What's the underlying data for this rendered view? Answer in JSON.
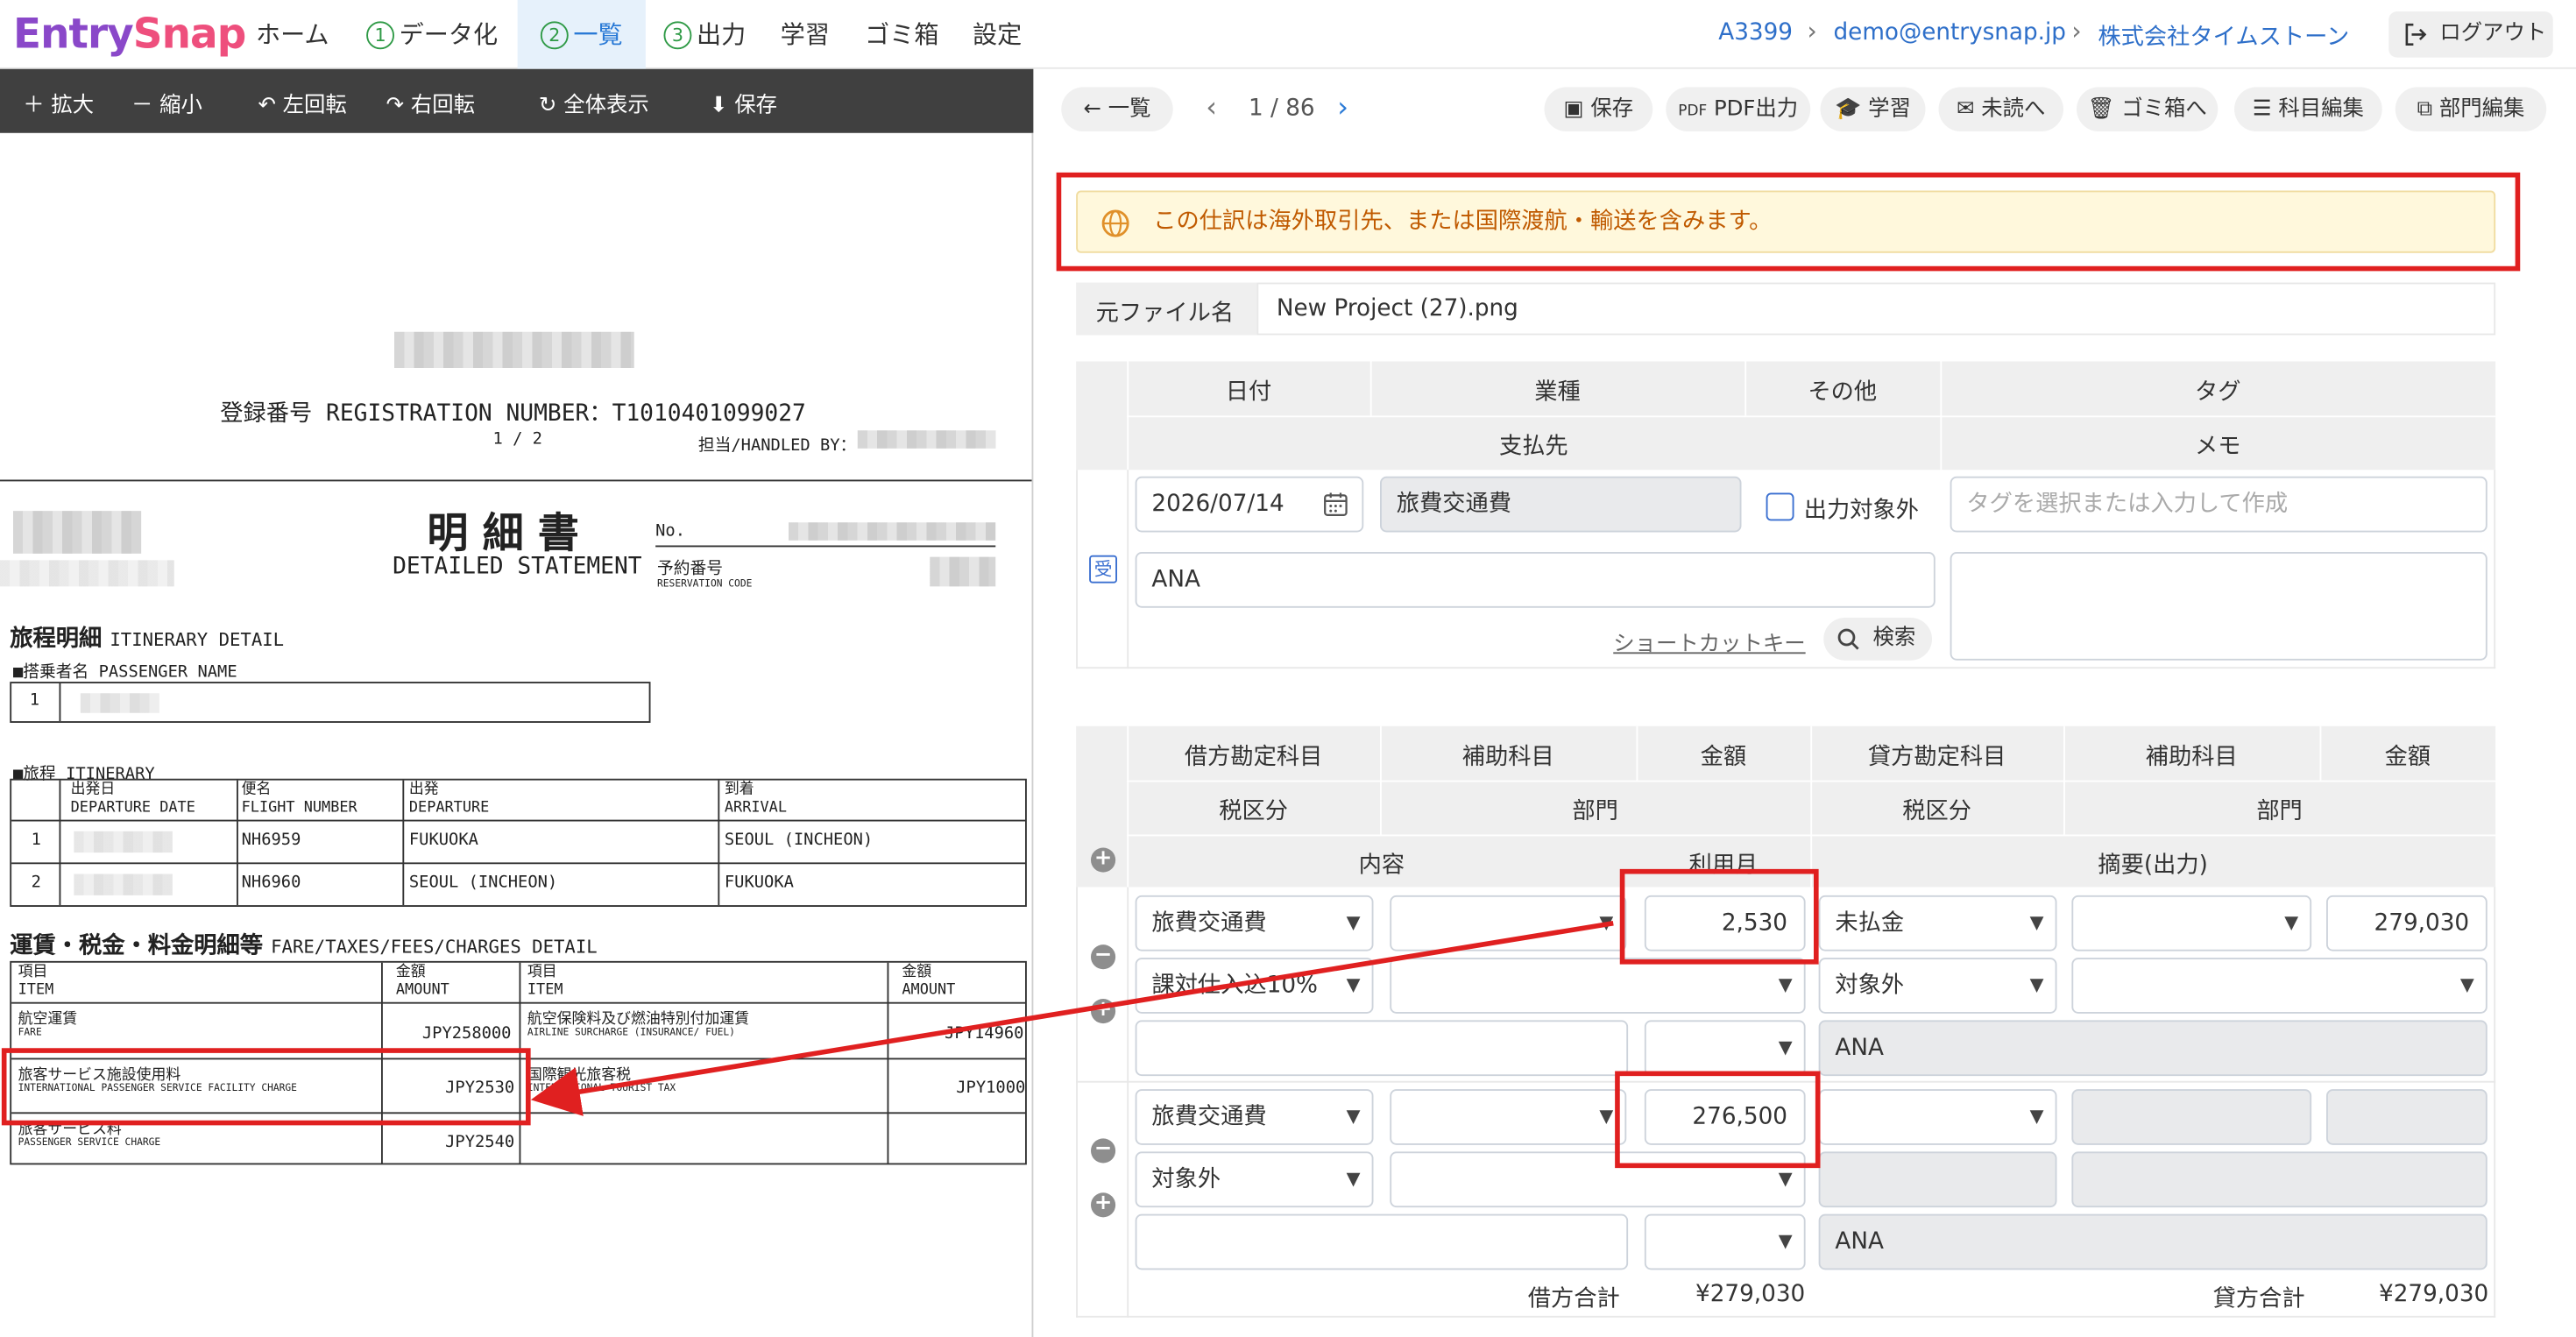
{
  "header": {
    "logo_a": "Entry",
    "logo_b": "Snap",
    "nav": [
      {
        "label": "ホーム"
      },
      {
        "num": "1",
        "label": "データ化"
      },
      {
        "num": "2",
        "label": "一覧"
      },
      {
        "num": "3",
        "label": "出力"
      },
      {
        "label": "学習"
      },
      {
        "label": "ゴミ箱"
      },
      {
        "label": "設定"
      }
    ],
    "breadcrumb": [
      "A3399",
      "demo@entrysnap.jp",
      "株式会社タイムストーン"
    ],
    "logout": "ログアウト"
  },
  "viewer_toolbar": [
    "拡大",
    "縮小",
    "左回転",
    "右回転",
    "全体表示",
    "保存"
  ],
  "document": {
    "reg": "登録番号 REGISTRATION NUMBER：T1010401099027",
    "page": "1 / 2",
    "handled": "担当/HANDLED BY：",
    "title_jp": "明 細 書",
    "title_en": "DETAILED STATEMENT",
    "no": "No.",
    "resv_jp": "予約番号",
    "resv_en": "RESERVATION CODE",
    "itin_title": "旅程明細",
    "itin_title_en": "ITINERARY DETAIL",
    "pax": "■搭乗者名 PASSENGER NAME",
    "pax_no": "1",
    "itin": "■旅程 ITINERARY",
    "cols": [
      {
        "jp": "出発日",
        "en": "DEPARTURE DATE"
      },
      {
        "jp": "便名",
        "en": "FLIGHT NUMBER"
      },
      {
        "jp": "出発",
        "en": "DEPARTURE"
      },
      {
        "jp": "到着",
        "en": "ARRIVAL"
      }
    ],
    "rows": [
      {
        "no": "1",
        "flight": "NH6959",
        "dep": "FUKUOKA",
        "arr": "SEOUL (INCHEON)"
      },
      {
        "no": "2",
        "flight": "NH6960",
        "dep": "SEOUL (INCHEON)",
        "arr": "FUKUOKA"
      }
    ],
    "fare_title": "運賃・税金・料金明細等",
    "fare_title_en": "FARE/TAXES/FEES/CHARGES DETAIL",
    "fare_cols": {
      "item_jp": "項目",
      "item_en": "ITEM",
      "amt_jp": "金額",
      "amt_en": "AMOUNT"
    },
    "fare": [
      {
        "jp": "航空運賃",
        "en": "FARE",
        "amt": "JPY258000",
        "jp2": "航空保険料及び燃油特別付加運賃",
        "en2": "AIRLINE SURCHARGE (INSURANCE/ FUEL)",
        "amt2": "JPY14960"
      },
      {
        "jp": "旅客サービス施設使用料",
        "en": "INTERNATIONAL PASSENGER SERVICE FACILITY CHARGE",
        "amt": "JPY2530",
        "jp2": "国際観光旅客税",
        "en2": "INTERNATIONAL TOURIST TAX",
        "amt2": "JPY1000"
      },
      {
        "jp": "旅客サービス料",
        "en": "PASSENGER SERVICE CHARGE",
        "amt": "JPY2540",
        "jp2": "",
        "en2": "",
        "amt2": ""
      }
    ]
  },
  "right": {
    "back": "一覧",
    "pager": "1 / 86",
    "actions": [
      "保存",
      "PDF出力",
      "学習",
      "未読へ",
      "ゴミ箱へ",
      "科目編集",
      "部門編集"
    ],
    "notice": "この仕訳は海外取引先、または国際渡航・輸送を含みます。",
    "file_label": "元ファイル名",
    "file_name": "New Project (27).png",
    "h1": {
      "date": "日付",
      "industry": "業種",
      "other": "その他",
      "tag": "タグ",
      "payee": "支払先",
      "memo": "メモ"
    },
    "date": "2026/07/14",
    "industry_val": "旅費交通費",
    "exclude": "出力対象外",
    "tag_placeholder": "タグを選択または入力して作成",
    "receipt_badge": "受",
    "payee_val": "ANA",
    "shortcut": "ショートカットキー",
    "search": "検索",
    "h2": {
      "debit": "借方勘定科目",
      "sub": "補助科目",
      "amount": "金額",
      "credit": "貸方勘定科目",
      "sub2": "補助科目",
      "amount2": "金額",
      "tax": "税区分",
      "dept": "部門",
      "tax2": "税区分",
      "dept2": "部門",
      "content": "内容",
      "month": "利用月",
      "summary": "摘要(出力)"
    },
    "e1": {
      "debit": "旅費交通費",
      "amount": "2,530",
      "credit": "未払金",
      "credit_amount": "279,030",
      "tax": "課対仕入込10%",
      "tax2": "対象外",
      "summary": "ANA"
    },
    "e2": {
      "debit": "旅費交通費",
      "amount": "276,500",
      "tax": "対象外",
      "summary": "ANA"
    },
    "totals": {
      "debit_label": "借方合計",
      "debit": "¥279,030",
      "credit_label": "貸方合計",
      "credit": "¥279,030"
    }
  },
  "colors": {
    "accent": "#2a7ad6",
    "alert": "#e02020",
    "notice_bg": "#fff8dc",
    "notice_text": "#c05a00"
  }
}
